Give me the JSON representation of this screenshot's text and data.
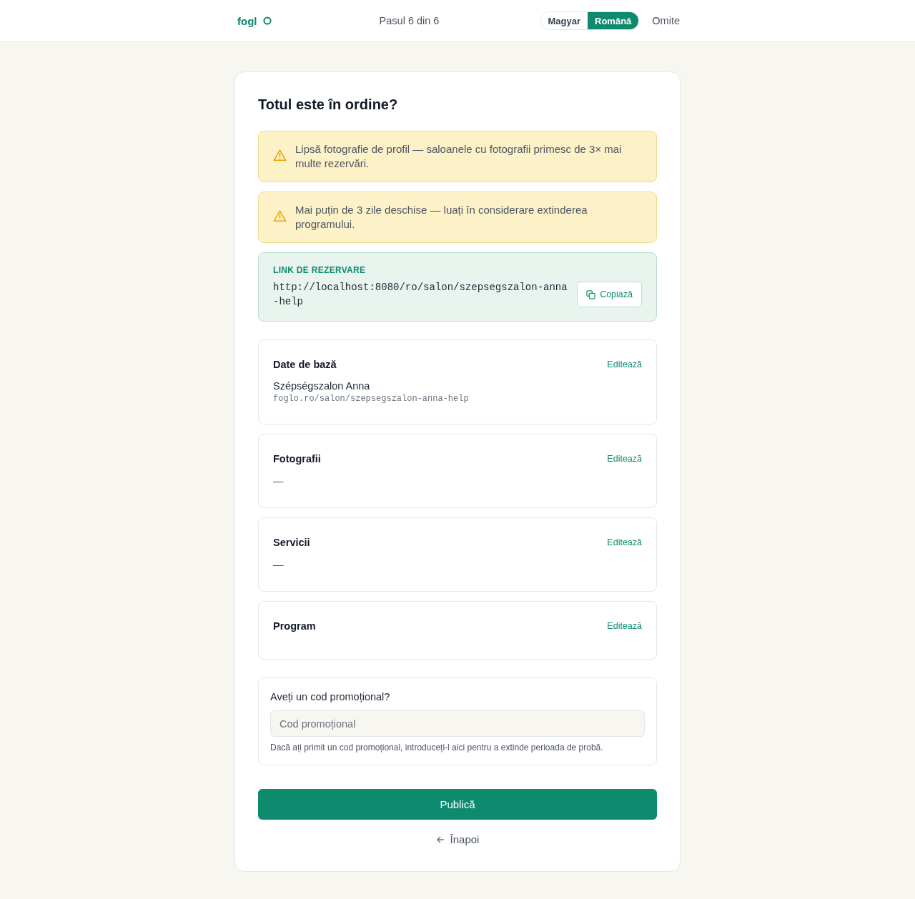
{
  "header": {
    "logo": "fogl",
    "step": "Pasul 6 din 6",
    "languages": [
      {
        "label": "Magyar",
        "selected": false
      },
      {
        "label": "Română",
        "selected": true
      }
    ],
    "skip": "Omite"
  },
  "page": {
    "title": "Totul este în ordine?",
    "warnings": [
      {
        "text": "Lipsă fotografie de profil — saloanele cu fotografii primesc de 3× mai multe rezervări."
      },
      {
        "text": "Mai puțin de 3 zile deschise — luați în considerare extinderea programului."
      }
    ],
    "booking_link": {
      "label": "LINK DE REZERVARE",
      "url": "http://localhost:8080/ro/salon/szepsegszalon-anna-help",
      "copy_button": "Copiază"
    },
    "sections": [
      {
        "title": "Date de bază",
        "edit": "Editează",
        "lines": [
          {
            "kind": "name",
            "text": "Szépségszalon Anna"
          },
          {
            "kind": "url",
            "text": "foglo.ro/salon/szepsegszalon-anna-help"
          }
        ]
      },
      {
        "title": "Fotografii",
        "edit": "Editează",
        "lines": [
          {
            "kind": "empty",
            "text": "—"
          }
        ]
      },
      {
        "title": "Servicii",
        "edit": "Editează",
        "lines": [
          {
            "kind": "empty",
            "text": "—"
          }
        ]
      },
      {
        "title": "Program",
        "edit": "Editează"
      }
    ],
    "promo": {
      "label": "Aveți un cod promoțional?",
      "placeholder": "Cod promoțional",
      "hint": "Dacă ați primit un cod promoțional, introduceți-l aici pentru a extinde perioada de probă."
    },
    "publish_button": "Publică",
    "back_link": "Înapoi"
  }
}
